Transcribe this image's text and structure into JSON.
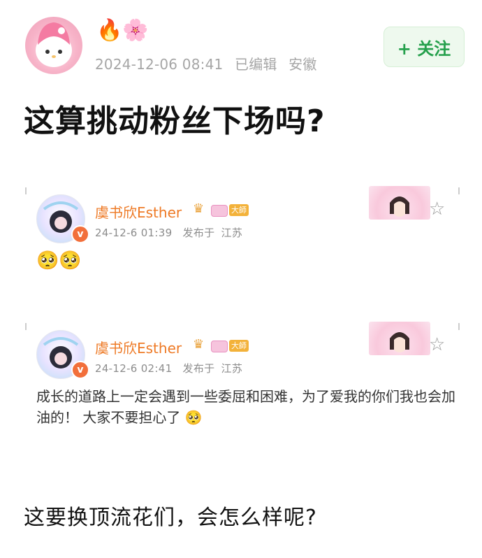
{
  "post": {
    "emojis": "🔥🌸",
    "timestamp": "2024-12-06 08:41",
    "edited": "已编辑",
    "location": "安徽",
    "follow_label": "+ 关注",
    "headline": "这算挑动粉丝下场吗?"
  },
  "cards": [
    {
      "name": "虞书欣Esther",
      "level": "大師",
      "date": "24-12-6 01:39",
      "location_label": "发布于",
      "location": "江苏",
      "emojis": "🥺🥺",
      "text": ""
    },
    {
      "name": "虞书欣Esther",
      "level": "大師",
      "date": "24-12-6 02:41",
      "location_label": "发布于",
      "location": "江苏",
      "emojis": "",
      "text": "成长的道路上一定会遇到一些委屈和困难，为了爱我的你们我也会加油的！ 大家不要担心了 🥺"
    }
  ],
  "bottom_text": "这要换顶流花们，会怎么样呢?",
  "icons": {
    "star": "☆",
    "crown": "♛",
    "verified": "v"
  },
  "colors": {
    "follow_green": "#25a04c",
    "name_orange": "#ee7a26",
    "meta_gray": "#a6a6a6"
  }
}
